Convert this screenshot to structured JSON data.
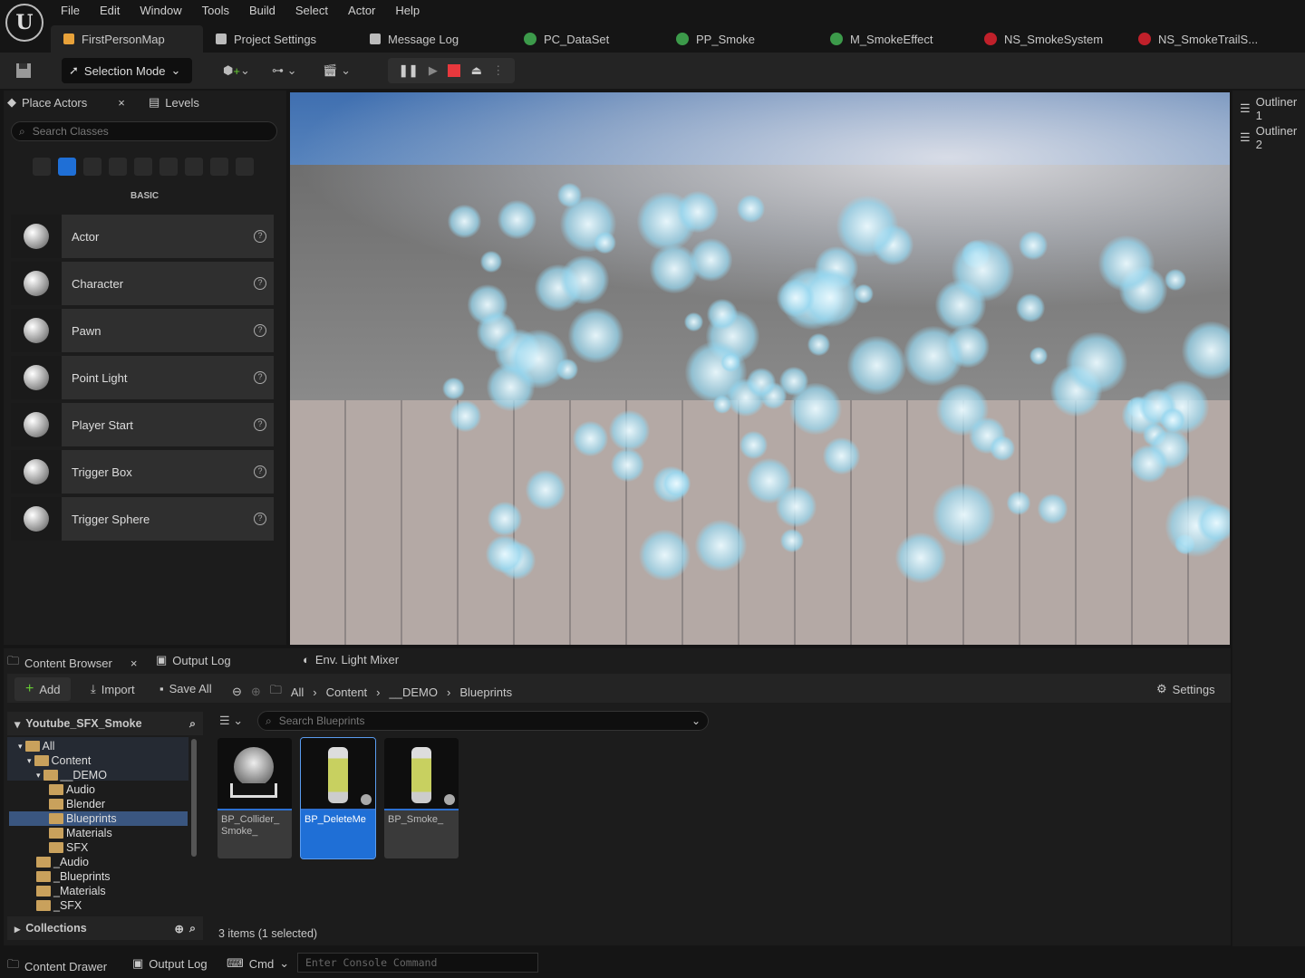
{
  "menu": [
    "File",
    "Edit",
    "Window",
    "Tools",
    "Build",
    "Select",
    "Actor",
    "Help"
  ],
  "tabs": [
    {
      "label": "FirstPersonMap",
      "color": "#e8a23a"
    },
    {
      "label": "Project Settings",
      "color": "#bbbbbb"
    },
    {
      "label": "Message Log",
      "color": "#bbbbbb"
    },
    {
      "label": "PC_DataSet",
      "color": "#3c9a4a"
    },
    {
      "label": "PP_Smoke",
      "color": "#3c9a4a"
    },
    {
      "label": "M_SmokeEffect",
      "color": "#3c9a4a"
    },
    {
      "label": "NS_SmokeSystem",
      "color": "#c0202a"
    },
    {
      "label": "NS_SmokeTrailS...",
      "color": "#c0202a"
    }
  ],
  "toolbar": {
    "selection_mode": "Selection Mode"
  },
  "place_actors": {
    "tab": "Place Actors",
    "levels_tab": "Levels",
    "search_placeholder": "Search Classes",
    "category": "BASIC",
    "items": [
      "Actor",
      "Character",
      "Pawn",
      "Point Light",
      "Player Start",
      "Trigger Box",
      "Trigger Sphere"
    ]
  },
  "outliners": [
    "Outliner 1",
    "Outliner 2"
  ],
  "bottom_tabs": [
    "Content Browser",
    "Output Log",
    "Env. Light Mixer"
  ],
  "content_browser": {
    "add": "Add",
    "import": "Import",
    "save_all": "Save All",
    "breadcrumb": [
      "All",
      "Content",
      "__DEMO",
      "Blueprints"
    ],
    "settings": "Settings",
    "project": "Youtube_SFX_Smoke",
    "search_placeholder": "Search Blueprints",
    "tree": [
      {
        "label": "All",
        "depth": 0
      },
      {
        "label": "Content",
        "depth": 1
      },
      {
        "label": "__DEMO",
        "depth": 2
      },
      {
        "label": "Audio",
        "depth": 3
      },
      {
        "label": "Blender",
        "depth": 3
      },
      {
        "label": "Blueprints",
        "depth": 3,
        "selected": true
      },
      {
        "label": "Materials",
        "depth": 3
      },
      {
        "label": "SFX",
        "depth": 3
      },
      {
        "label": "_Audio",
        "depth": 2
      },
      {
        "label": "_Blueprints",
        "depth": 2
      },
      {
        "label": "_Materials",
        "depth": 2
      },
      {
        "label": "_SFX",
        "depth": 2
      }
    ],
    "collections": "Collections",
    "assets": [
      {
        "name": "BP_Collider_ Smoke_",
        "selected": false
      },
      {
        "name": "BP_DeleteMe",
        "selected": true
      },
      {
        "name": "BP_Smoke_",
        "selected": false
      }
    ],
    "count": "3 items (1 selected)"
  },
  "statusbar": {
    "content_drawer": "Content Drawer",
    "output_log": "Output Log",
    "cmd": "Cmd",
    "console_placeholder": "Enter Console Command"
  },
  "accent": "#1f6fd6"
}
